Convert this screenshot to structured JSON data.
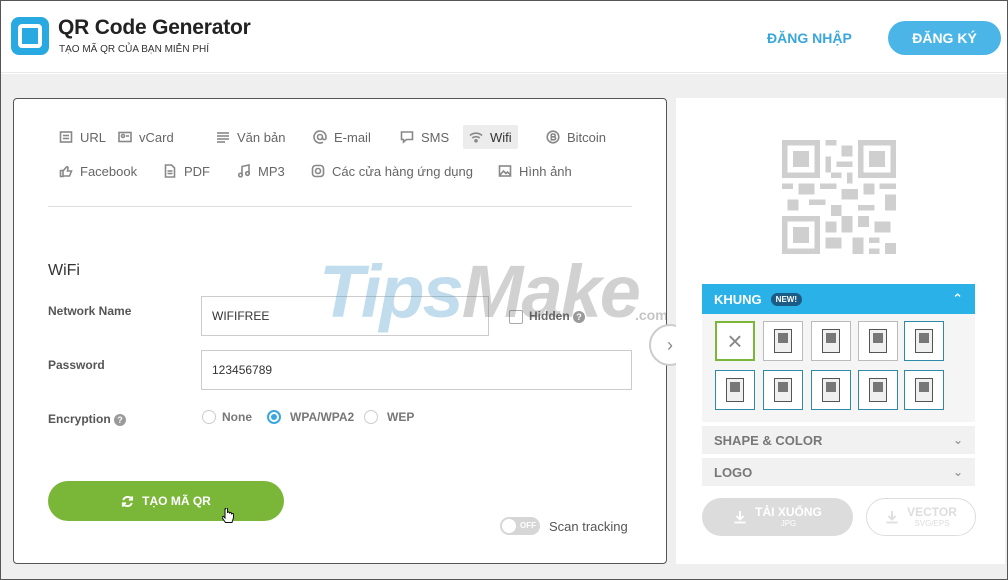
{
  "header": {
    "title": "QR Code Generator",
    "subtitle": "TẠO MÃ QR CỦA BẠN MIỄN PHÍ",
    "login": "ĐĂNG NHẬP",
    "signup": "ĐĂNG KÝ"
  },
  "tabs": [
    {
      "label": "URL",
      "icon": "document-icon",
      "active": false
    },
    {
      "label": "vCard",
      "icon": "contact-card-icon",
      "active": false
    },
    {
      "label": "Văn bản",
      "icon": "text-lines-icon",
      "active": false
    },
    {
      "label": "E-mail",
      "icon": "at-sign-icon",
      "active": false
    },
    {
      "label": "SMS",
      "icon": "chat-bubble-icon",
      "active": false
    },
    {
      "label": "Wifi",
      "icon": "wifi-icon",
      "active": true
    },
    {
      "label": "Bitcoin",
      "icon": "bitcoin-icon",
      "active": false
    },
    {
      "label": "Facebook",
      "icon": "thumbs-up-icon",
      "active": false
    },
    {
      "label": "PDF",
      "icon": "pdf-icon",
      "active": false
    },
    {
      "label": "MP3",
      "icon": "music-note-icon",
      "active": false
    },
    {
      "label": "Các cửa hàng ứng dụng",
      "icon": "app-store-icon",
      "active": false
    },
    {
      "label": "Hình ảnh",
      "icon": "image-icon",
      "active": false
    }
  ],
  "form": {
    "section_title": "WiFi",
    "network_label": "Network Name",
    "network_value": "WIFIFREE",
    "hidden_label": "Hidden",
    "password_label": "Password",
    "password_value": "123456789",
    "encryption_label": "Encryption",
    "encryption_options": [
      "None",
      "WPA/WPA2",
      "WEP"
    ],
    "encryption_selected": "WPA/WPA2",
    "create_button": "TẠO MÃ QR",
    "toggle_state": "OFF",
    "scan_tracking": "Scan tracking"
  },
  "watermark": {
    "tips": "Tips",
    "make": "Make",
    "dotcom": ".com"
  },
  "right": {
    "frame_title": "KHUNG",
    "new_badge": "NEW!",
    "frame_options_count": 10,
    "shape_color": "SHAPE & COLOR",
    "logo": "LOGO",
    "download_main": "TẢI XUỐNG",
    "download_sub": "JPG",
    "vector_main": "VECTOR",
    "vector_sub": "SVG/EPS"
  },
  "colors": {
    "accent_blue": "#29b1e8",
    "green": "#7ab638",
    "link_blue": "#39a6dc"
  }
}
